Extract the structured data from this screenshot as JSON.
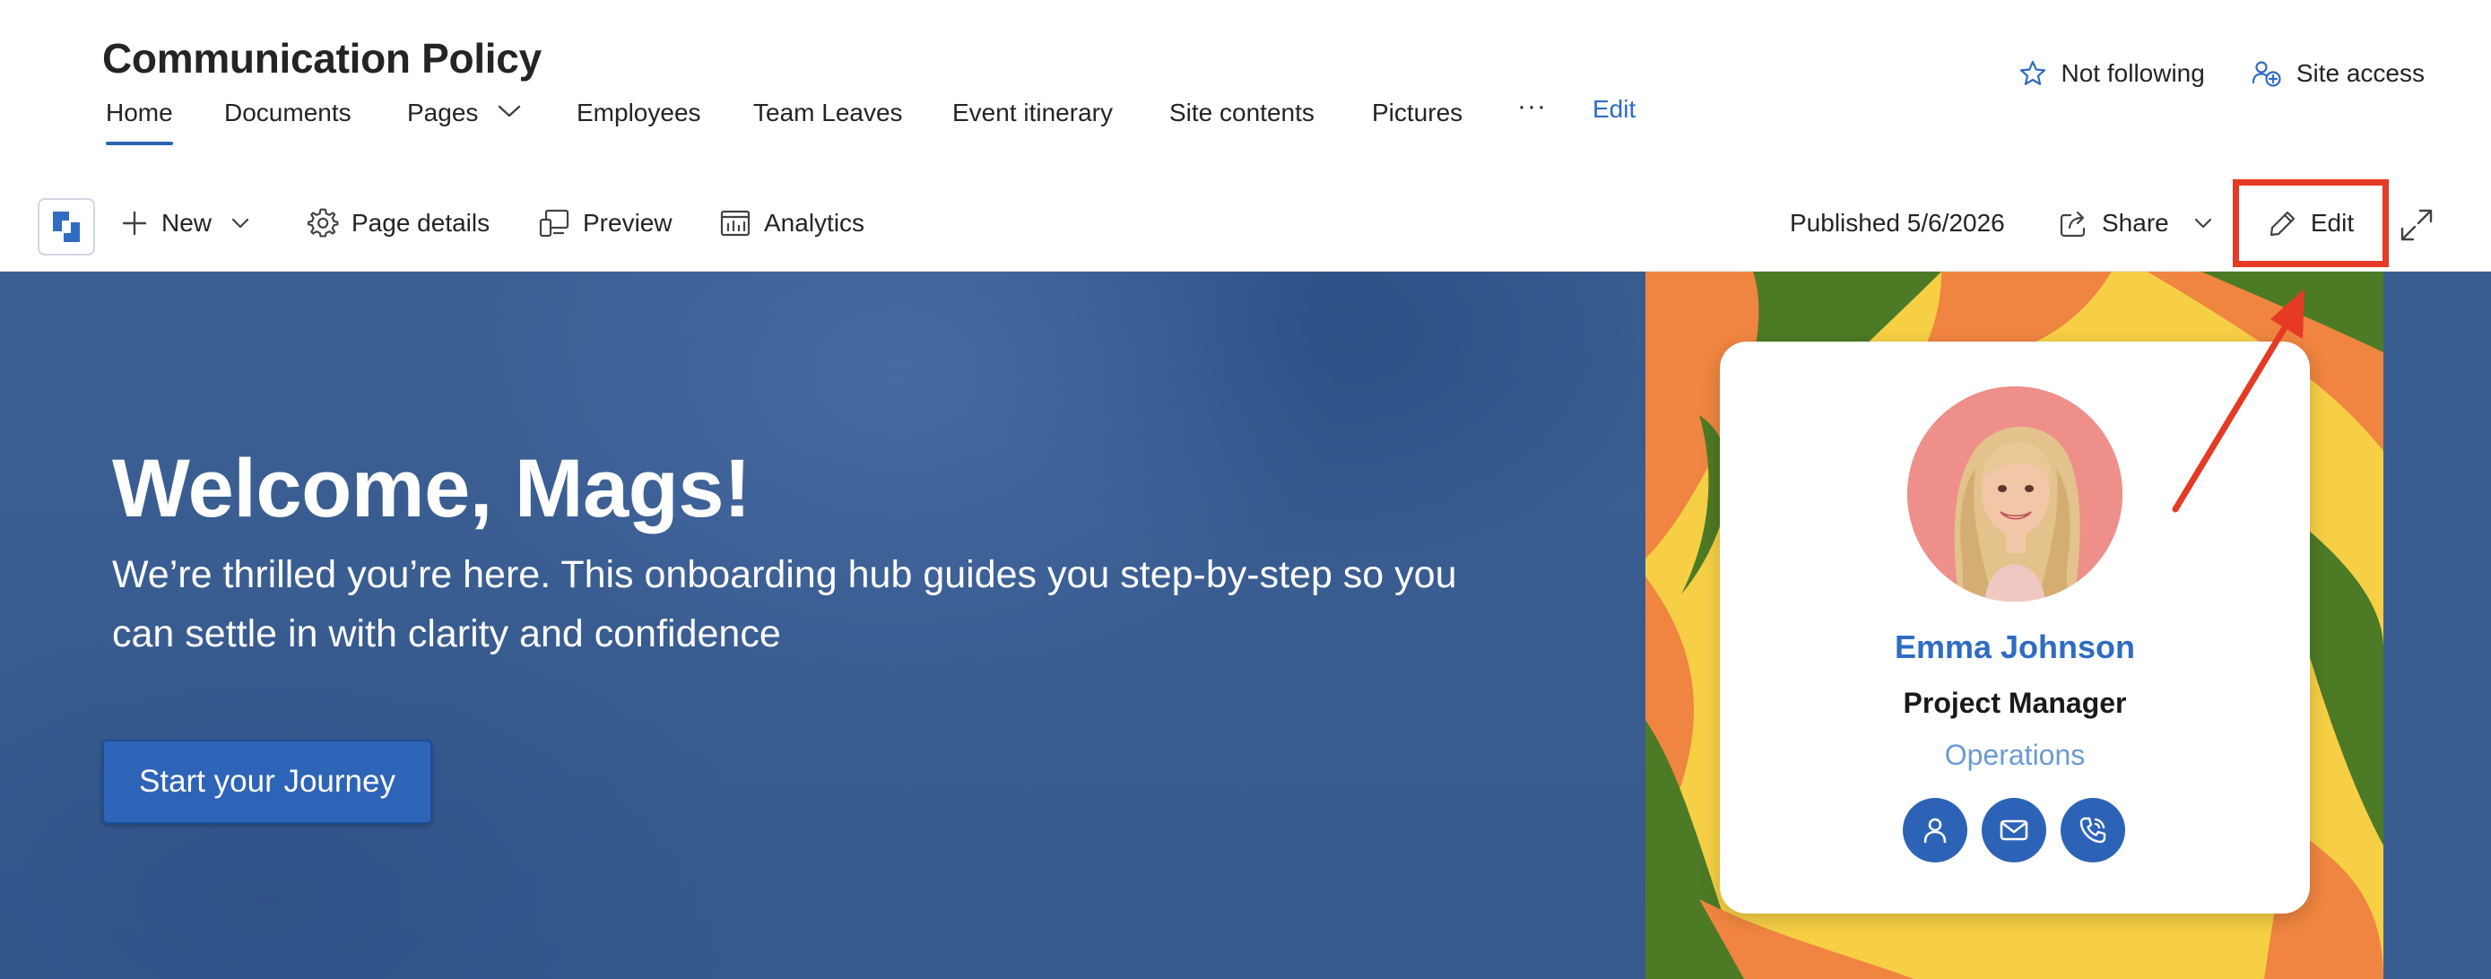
{
  "site": {
    "title": "Communication Policy",
    "nav": [
      {
        "label": "Home",
        "active": true
      },
      {
        "label": "Documents"
      },
      {
        "label": "Pages",
        "has_dropdown": true
      },
      {
        "label": "Employees"
      },
      {
        "label": "Team Leaves"
      },
      {
        "label": "Event itinerary"
      },
      {
        "label": "Site contents"
      },
      {
        "label": "Pictures"
      },
      {
        "label": "···"
      },
      {
        "label": "Edit"
      }
    ],
    "follow_label": "Not following",
    "site_access_label": "Site access"
  },
  "command_bar": {
    "new_label": "New",
    "page_details_label": "Page details",
    "preview_label": "Preview",
    "analytics_label": "Analytics",
    "published_label": "Published 5/6/2026",
    "share_label": "Share",
    "edit_label": "Edit"
  },
  "hero": {
    "title": "Welcome, Mags!",
    "subtitle": "We’re thrilled you’re here. This onboarding hub guides you step-by-step so you can settle in with clarity and confidence",
    "cta_label": "Start your Journey"
  },
  "profile_card": {
    "name": "Emma Johnson",
    "role": "Project Manager",
    "department": "Operations"
  },
  "colors": {
    "accent": "#2f6cc2",
    "hero_background": "#3a5d91",
    "highlight_box": "#e53a24",
    "pattern_yellow": "#f6cf45",
    "pattern_orange": "#ef8540",
    "pattern_green": "#4d7a25"
  },
  "icons": [
    "star-icon",
    "site-access-icon",
    "app-logo-icon",
    "plus-icon",
    "chevron-down-icon",
    "gear-icon",
    "preview-icon",
    "analytics-icon",
    "share-icon",
    "pencil-icon",
    "expand-icon",
    "person-icon",
    "mail-icon",
    "phone-icon"
  ]
}
